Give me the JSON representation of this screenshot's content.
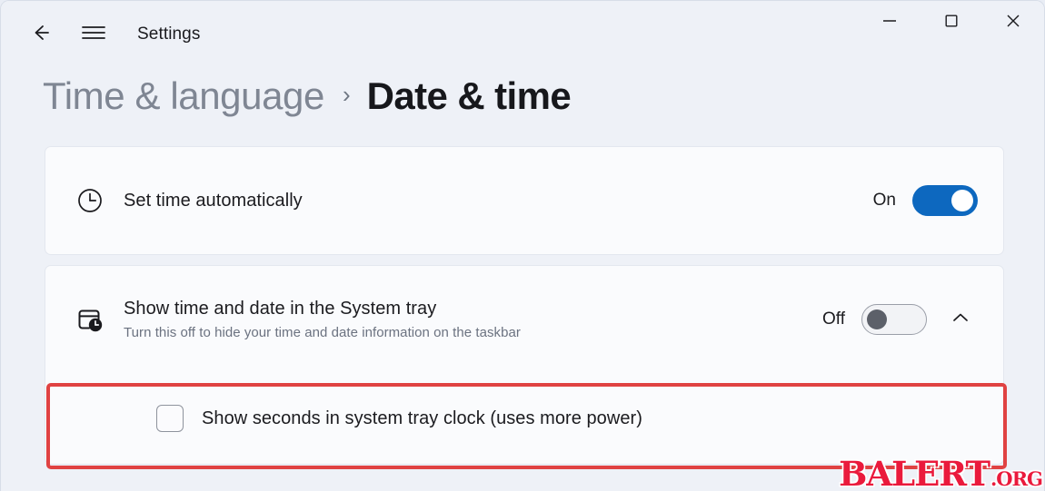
{
  "window": {
    "app_title": "Settings",
    "back_icon": "back-arrow-icon",
    "menu_icon": "hamburger-menu-icon",
    "minimize_icon": "minimize-icon",
    "maximize_icon": "maximize-icon",
    "close_icon": "close-icon"
  },
  "breadcrumb": {
    "parent": "Time & language",
    "separator": "›",
    "current": "Date & time"
  },
  "settings": {
    "set_time": {
      "icon": "clock-icon",
      "title": "Set time automatically",
      "state_label": "On",
      "toggle_state": "on"
    },
    "system_tray": {
      "icon": "calendar-clock-icon",
      "title": "Show time and date in the System tray",
      "subtitle": "Turn this off to hide your time and date information on the taskbar",
      "state_label": "Off",
      "toggle_state": "off",
      "expand_icon": "chevron-up-icon"
    },
    "show_seconds": {
      "label": "Show seconds in system tray clock (uses more power)",
      "checked": false
    }
  },
  "annotation": {
    "color": "#e04242"
  },
  "watermark": {
    "main": "BALERT",
    "tld": ".ORG",
    "color": "#ea1a3c"
  }
}
